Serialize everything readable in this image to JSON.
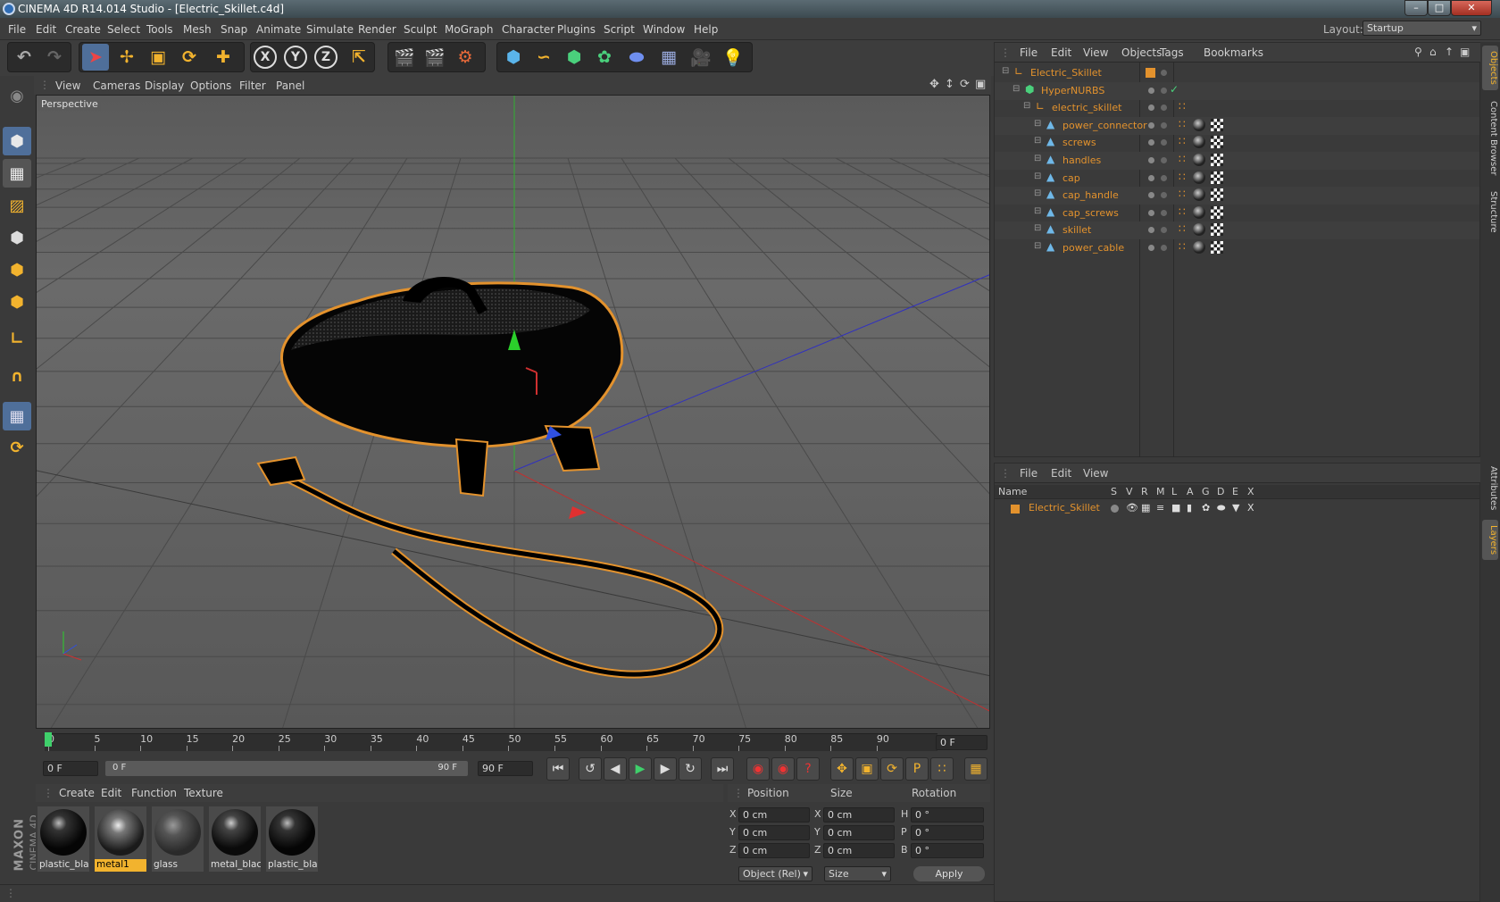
{
  "window": {
    "title": "CINEMA 4D R14.014 Studio - [Electric_Skillet.c4d]",
    "layout_label": "Layout:",
    "layout_value": "Startup"
  },
  "menu": [
    "File",
    "Edit",
    "Create",
    "Select",
    "Tools",
    "Mesh",
    "Snap",
    "Animate",
    "Simulate",
    "Render",
    "Sculpt",
    "MoGraph",
    "Character",
    "Plugins",
    "Script",
    "Window",
    "Help"
  ],
  "toolbar": {
    "icons": [
      "undo-icon",
      "redo-icon",
      "live-selection-icon",
      "move-icon",
      "scale-icon",
      "rotate-icon",
      "create-object-icon",
      "x-axis-icon",
      "y-axis-icon",
      "z-axis-icon",
      "coordinate-system-icon",
      "render-view-icon",
      "render-picture-viewer-icon",
      "render-settings-icon",
      "cube-icon",
      "spline-icon",
      "nurbs-icon",
      "array-icon",
      "deformer-icon",
      "floor-icon",
      "camera-icon",
      "light-icon"
    ],
    "axis_labels": [
      "X",
      "Y",
      "Z"
    ]
  },
  "viewport": {
    "menu": [
      "View",
      "Cameras",
      "Display",
      "Options",
      "Filter",
      "Panel"
    ],
    "label": "Perspective"
  },
  "timeline": {
    "ticks": [
      "0",
      "5",
      "10",
      "15",
      "20",
      "25",
      "30",
      "35",
      "40",
      "45",
      "50",
      "55",
      "60",
      "65",
      "70",
      "75",
      "80",
      "85",
      "90"
    ],
    "current_frame": "0 F"
  },
  "playback": {
    "start": "0 F",
    "range_start": "0 F",
    "range_end": "90 F",
    "end": "90 F"
  },
  "materials": {
    "menu": [
      "Create",
      "Edit",
      "Function",
      "Texture"
    ],
    "items": [
      {
        "name": "plastic_blac",
        "selected": false
      },
      {
        "name": "metal1",
        "selected": true
      },
      {
        "name": "glass",
        "selected": false
      },
      {
        "name": "metal_black",
        "selected": false
      },
      {
        "name": "plastic_blac",
        "selected": false
      }
    ]
  },
  "coordinates": {
    "headers": [
      "Position",
      "Size",
      "Rotation"
    ],
    "rows": [
      {
        "axis": "X",
        "pos": "0 cm",
        "size_axis": "X",
        "size": "0 cm",
        "rot_axis": "H",
        "rot": "0 °"
      },
      {
        "axis": "Y",
        "pos": "0 cm",
        "size_axis": "Y",
        "size": "0 cm",
        "rot_axis": "P",
        "rot": "0 °"
      },
      {
        "axis": "Z",
        "pos": "0 cm",
        "size_axis": "Z",
        "size": "0 cm",
        "rot_axis": "B",
        "rot": "0 °"
      }
    ],
    "mode": "Object (Rel)",
    "size_mode": "Size",
    "apply": "Apply"
  },
  "objects": {
    "menu": [
      "File",
      "Edit",
      "View",
      "Objects",
      "Tags",
      "Bookmarks"
    ],
    "items": [
      {
        "name": "Electric_Skillet",
        "indent": 0,
        "type": "null"
      },
      {
        "name": "HyperNURBS",
        "indent": 1,
        "type": "nurbs"
      },
      {
        "name": "electric_skillet",
        "indent": 2,
        "type": "null"
      },
      {
        "name": "power_connector",
        "indent": 3,
        "type": "poly"
      },
      {
        "name": "screws",
        "indent": 3,
        "type": "poly"
      },
      {
        "name": "handles",
        "indent": 3,
        "type": "poly"
      },
      {
        "name": "cap",
        "indent": 3,
        "type": "poly"
      },
      {
        "name": "cap_handle",
        "indent": 3,
        "type": "poly"
      },
      {
        "name": "cap_screws",
        "indent": 3,
        "type": "poly"
      },
      {
        "name": "skillet",
        "indent": 3,
        "type": "poly"
      },
      {
        "name": "power_cable",
        "indent": 3,
        "type": "poly"
      }
    ]
  },
  "layers": {
    "menu": [
      "File",
      "Edit",
      "View"
    ],
    "columns": [
      "Name",
      "S",
      "V",
      "R",
      "M",
      "L",
      "A",
      "G",
      "D",
      "E",
      "X"
    ],
    "items": [
      {
        "name": "Electric_Skillet"
      }
    ]
  },
  "side_tabs": [
    "Objects",
    "Content Browser",
    "Structure",
    "Attributes",
    "Layers"
  ],
  "branding": {
    "maxon": "MAXON",
    "product": "CINEMA 4D"
  },
  "colors": {
    "accent": "#e3922d",
    "panel": "#3a3a3a",
    "viewport": "#5e5e5e"
  }
}
